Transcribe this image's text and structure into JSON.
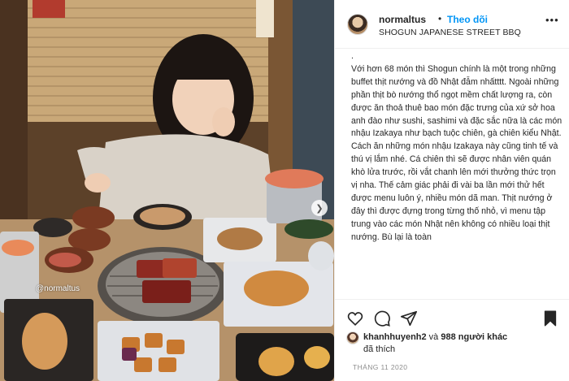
{
  "post": {
    "watermark": "@normaltus"
  },
  "header": {
    "username": "normaltus",
    "separator": "•",
    "follow_label": "Theo dõi",
    "location": "SHOGUN JAPANESE STREET BBQ"
  },
  "caption": {
    "lead": ".",
    "body": "Với hơn 68 món thì Shogun chính là một trong những buffet thịt nướng và đồ Nhật đẫm nhấtttt. Ngoài những phần thịt bò nướng thổ ngọt mềm chất lượng ra, còn được ăn thoả thuê bao món đặc trưng của xứ sở hoa anh đào như sushi, sashimi và đặc sắc nữa là các món nhậu Izakaya như bạch tuộc chiên, gà chiên kiểu Nhật. Cách ăn những món nhậu Izakaya này cũng tinh tế và thú vị lắm nhé. Cá chiên thì sẽ được nhân viên quán khò lửa trước, rồi vắt chanh lên mới thưởng thức trọn vị nha. Thế cảm giác phải đi vài ba lần mới thử hết được menu luôn ý, nhiều món dã man. Thịt nướng ở đây thì được đựng trong từng thố nhỏ, vì menu tập trung vào các món Nhật nên không có nhiều loại thịt nướng. Bù lại là toàn"
  },
  "likes": {
    "user": "khanhhuyenh2",
    "middle": " và ",
    "count": "988 người khác",
    "liked_label": "đã thích"
  },
  "date": "THÁNG 11 2020",
  "icons": {
    "like": "heart-icon",
    "comment": "comment-icon",
    "share": "send-icon",
    "save": "bookmark-icon",
    "more": "more-icon",
    "next": "chevron-right-icon"
  },
  "colors": {
    "accent": "#0095f6",
    "text": "#262626",
    "muted": "#8e8e8e",
    "border": "#efefef"
  }
}
